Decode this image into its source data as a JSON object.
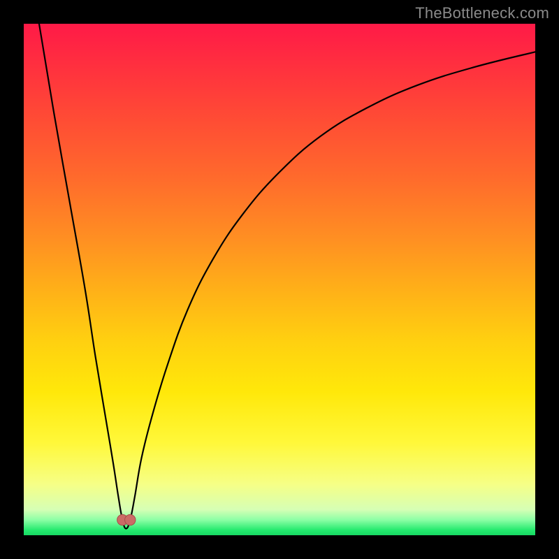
{
  "watermark": "TheBottleneck.com",
  "chart_data": {
    "type": "line",
    "title": "",
    "xlabel": "",
    "ylabel": "",
    "xlim": [
      0,
      100
    ],
    "ylim": [
      0,
      100
    ],
    "grid": false,
    "legend": false,
    "background_gradient": {
      "top_color": "#ff1a47",
      "mid_color": "#ffd010",
      "bottom_color": "#17d964"
    },
    "series": [
      {
        "name": "bottleneck-curve",
        "color": "#000000",
        "x": [
          3,
          6,
          9,
          12,
          14,
          16,
          17.5,
          18.5,
          19.3,
          20.0,
          20.8,
          21.7,
          23,
          25,
          28,
          32,
          37,
          43,
          50,
          58,
          67,
          77,
          88,
          100
        ],
        "values": [
          100,
          82,
          65,
          48,
          35,
          23,
          14,
          7.5,
          3.0,
          1.3,
          3.0,
          7.5,
          15,
          23,
          33,
          44,
          54,
          63,
          71,
          78,
          83.5,
          88,
          91.5,
          94.5
        ]
      }
    ],
    "markers": [
      {
        "name": "left-dot",
        "x": 19.3,
        "y": 3.0,
        "r": 1.4,
        "color": "#cb6b66"
      },
      {
        "name": "right-dot",
        "x": 20.8,
        "y": 3.0,
        "r": 1.4,
        "color": "#cb6b66"
      }
    ]
  }
}
